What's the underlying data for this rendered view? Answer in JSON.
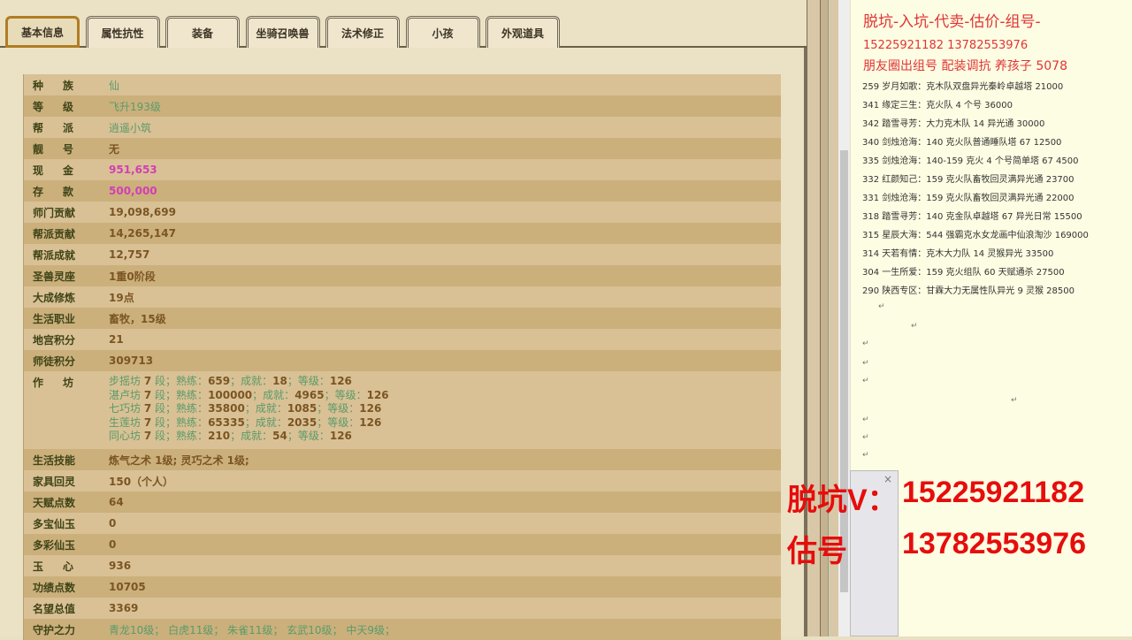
{
  "tabs": [
    "基本信息",
    "属性抗性",
    "装备",
    "坐骑召唤兽",
    "法术修正",
    "小孩",
    "外观道具"
  ],
  "rows_top": [
    {
      "label": "种族",
      "value": "仙",
      "style": "green",
      "spaced": true
    },
    {
      "label": "等级",
      "value": "飞升193级",
      "style": "green",
      "spaced": true
    },
    {
      "label": "帮派",
      "value": "逍遥小筑",
      "style": "green",
      "spaced": true
    },
    {
      "label": "靓号",
      "value": "无",
      "style": "",
      "spaced": true
    },
    {
      "label": "现金",
      "value": "951,653",
      "style": "pink",
      "spaced": true
    },
    {
      "label": "存款",
      "value": "500,000",
      "style": "pink",
      "spaced": true
    },
    {
      "label": "师门贡献",
      "value": "19,098,699",
      "style": ""
    },
    {
      "label": "帮派贡献",
      "value": "14,265,147",
      "style": ""
    },
    {
      "label": "帮派成就",
      "value": "12,757",
      "style": ""
    },
    {
      "label": "圣兽灵座",
      "value": "1重0阶段",
      "style": ""
    },
    {
      "label": "大成修炼",
      "value": "19点",
      "style": ""
    },
    {
      "label": "生活职业",
      "value": "畜牧，15级",
      "style": ""
    },
    {
      "label": "地宫积分",
      "value": "21",
      "style": ""
    },
    {
      "label": "师徒积分",
      "value": "309713",
      "style": ""
    }
  ],
  "workshop": {
    "label": "作坊",
    "lines": [
      {
        "name": "步摇坊",
        "dan": "7",
        "skill": "659",
        "ach": "18",
        "lvl": "126"
      },
      {
        "name": "湛卢坊",
        "dan": "7",
        "skill": "100000",
        "ach": "4965",
        "lvl": "126"
      },
      {
        "name": "七巧坊",
        "dan": "7",
        "skill": "35800",
        "ach": "1085",
        "lvl": "126"
      },
      {
        "name": "生莲坊",
        "dan": "7",
        "skill": "65335",
        "ach": "2035",
        "lvl": "126"
      },
      {
        "name": "同心坊",
        "dan": "7",
        "skill": "210",
        "ach": "54",
        "lvl": "126"
      }
    ],
    "dan_word": "段；",
    "skill_word": "熟练：",
    "ach_word": "；成就：",
    "lvl_word": "；等级："
  },
  "rows_bottom": [
    {
      "label": "生活技能",
      "value": "炼气之术 1级; 灵巧之术 1级;",
      "style": ""
    },
    {
      "label": "家具回灵",
      "value": "150（个人）",
      "style": ""
    },
    {
      "label": "天赋点数",
      "value": "64",
      "style": ""
    },
    {
      "label": "多宝仙玉",
      "value": "0",
      "style": ""
    },
    {
      "label": "多彩仙玉",
      "value": "0",
      "style": ""
    },
    {
      "label": "玉心",
      "value": "936",
      "style": "",
      "spaced": true
    },
    {
      "label": "功绩点数",
      "value": "10705",
      "style": ""
    },
    {
      "label": "名望总值",
      "value": "3369",
      "style": ""
    },
    {
      "label": "守护之力",
      "value": "青龙10级；  白虎11级；  朱雀11级；  玄武10级；  中天9级；",
      "style": "green"
    }
  ],
  "note": {
    "title": "脱坑-入坑-代卖-估价-组号-",
    "phones": "15225921182    13782553976",
    "promo": "朋友圈出组号   配装调抗  养孩子 5078",
    "lines": [
      "259 岁月如歌：克木队双盘异光秦岭卓越塔 21000",
      "341 缘定三生：克火队 4 个号 36000",
      "342 踏雪寻芳：大力克木队 14 异光通 30000",
      "340 剑烛沧海：140 克火队普通睡队塔 67  12500",
      "335 剑烛沧海：140-159 克火 4 个号简单塔 67  4500",
      "332 红颜知己：159 克火队畜牧回灵满异光通 23700",
      "331 剑烛沧海：159 克火队畜牧回灵满异光通 22000",
      "318 踏雪寻芳：140 克金队卓越塔 67 异光日常 15500",
      "315 星辰大海：544 强霸克水女龙画中仙浪淘沙 169000",
      "314 天若有情：克木大力队 14 灵猴异光 33500",
      "304 一生所爱：159 克火组队 60 天赋通杀 27500",
      "290 陕西专区：甘霖大力无属性队异光 9 灵猴 28500"
    ]
  },
  "overlay": {
    "line1_label": "脱坑V：",
    "line1_value": "15225921182",
    "line2_label": "估号",
    "line2_value": "13782553976"
  },
  "dialog_close": "×"
}
